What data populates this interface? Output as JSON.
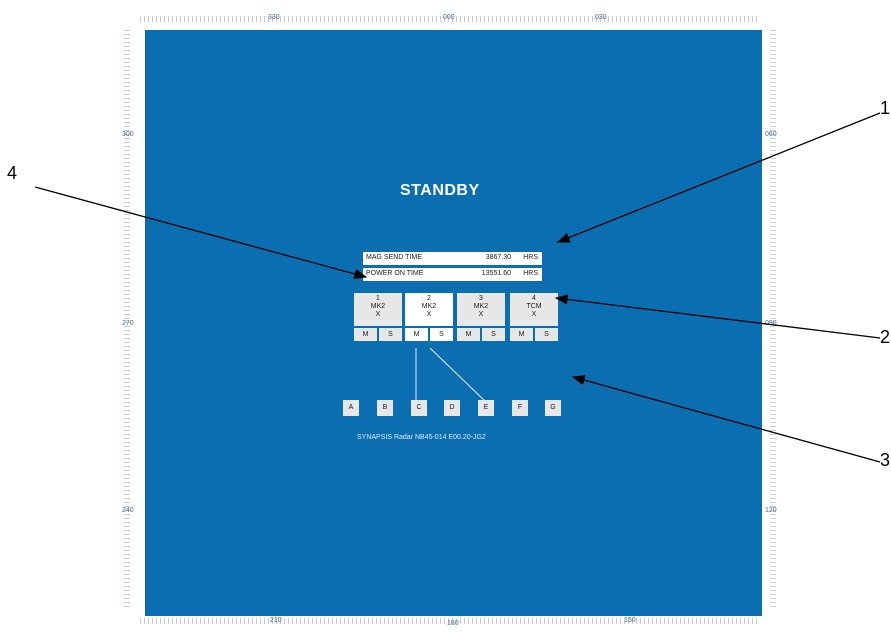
{
  "bezel": {
    "degree_labels": {
      "top": [
        "330",
        "000",
        "030"
      ],
      "bottom": [
        "210",
        "180",
        "150"
      ],
      "left": [
        "300",
        "270",
        "240"
      ],
      "right": [
        "060",
        "090",
        "120"
      ]
    }
  },
  "display": {
    "status": "STANDBY",
    "mag_send": {
      "label": "MAG SEND TIME",
      "value": "3867.30",
      "unit": "HRS"
    },
    "power_on": {
      "label": "POWER ON TIME",
      "value": "13551.60",
      "unit": "HRS"
    },
    "transceivers": [
      {
        "number": "1",
        "model": "MK2",
        "state": "X",
        "master": "M",
        "slave": "S",
        "selected": false
      },
      {
        "number": "2",
        "model": "MK2",
        "state": "X",
        "master": "M",
        "slave": "S",
        "selected": true
      },
      {
        "number": "3",
        "model": "MK2",
        "state": "X",
        "master": "M",
        "slave": "S",
        "selected": false
      },
      {
        "number": "4",
        "model": "TCM",
        "state": "X",
        "master": "M",
        "slave": "S",
        "selected": false
      }
    ],
    "display_buttons": [
      "A",
      "B",
      "C",
      "D",
      "E",
      "F",
      "G"
    ],
    "version": "SYNAPSIS Radar NB45-014 E00.20-JG2"
  },
  "callouts": [
    "1",
    "2",
    "3",
    "4"
  ],
  "colors": {
    "screen": "#0a6eb0",
    "panel": "#e7e7e7",
    "selected_panel": "#ffffff",
    "text": "#1b1b1b"
  }
}
